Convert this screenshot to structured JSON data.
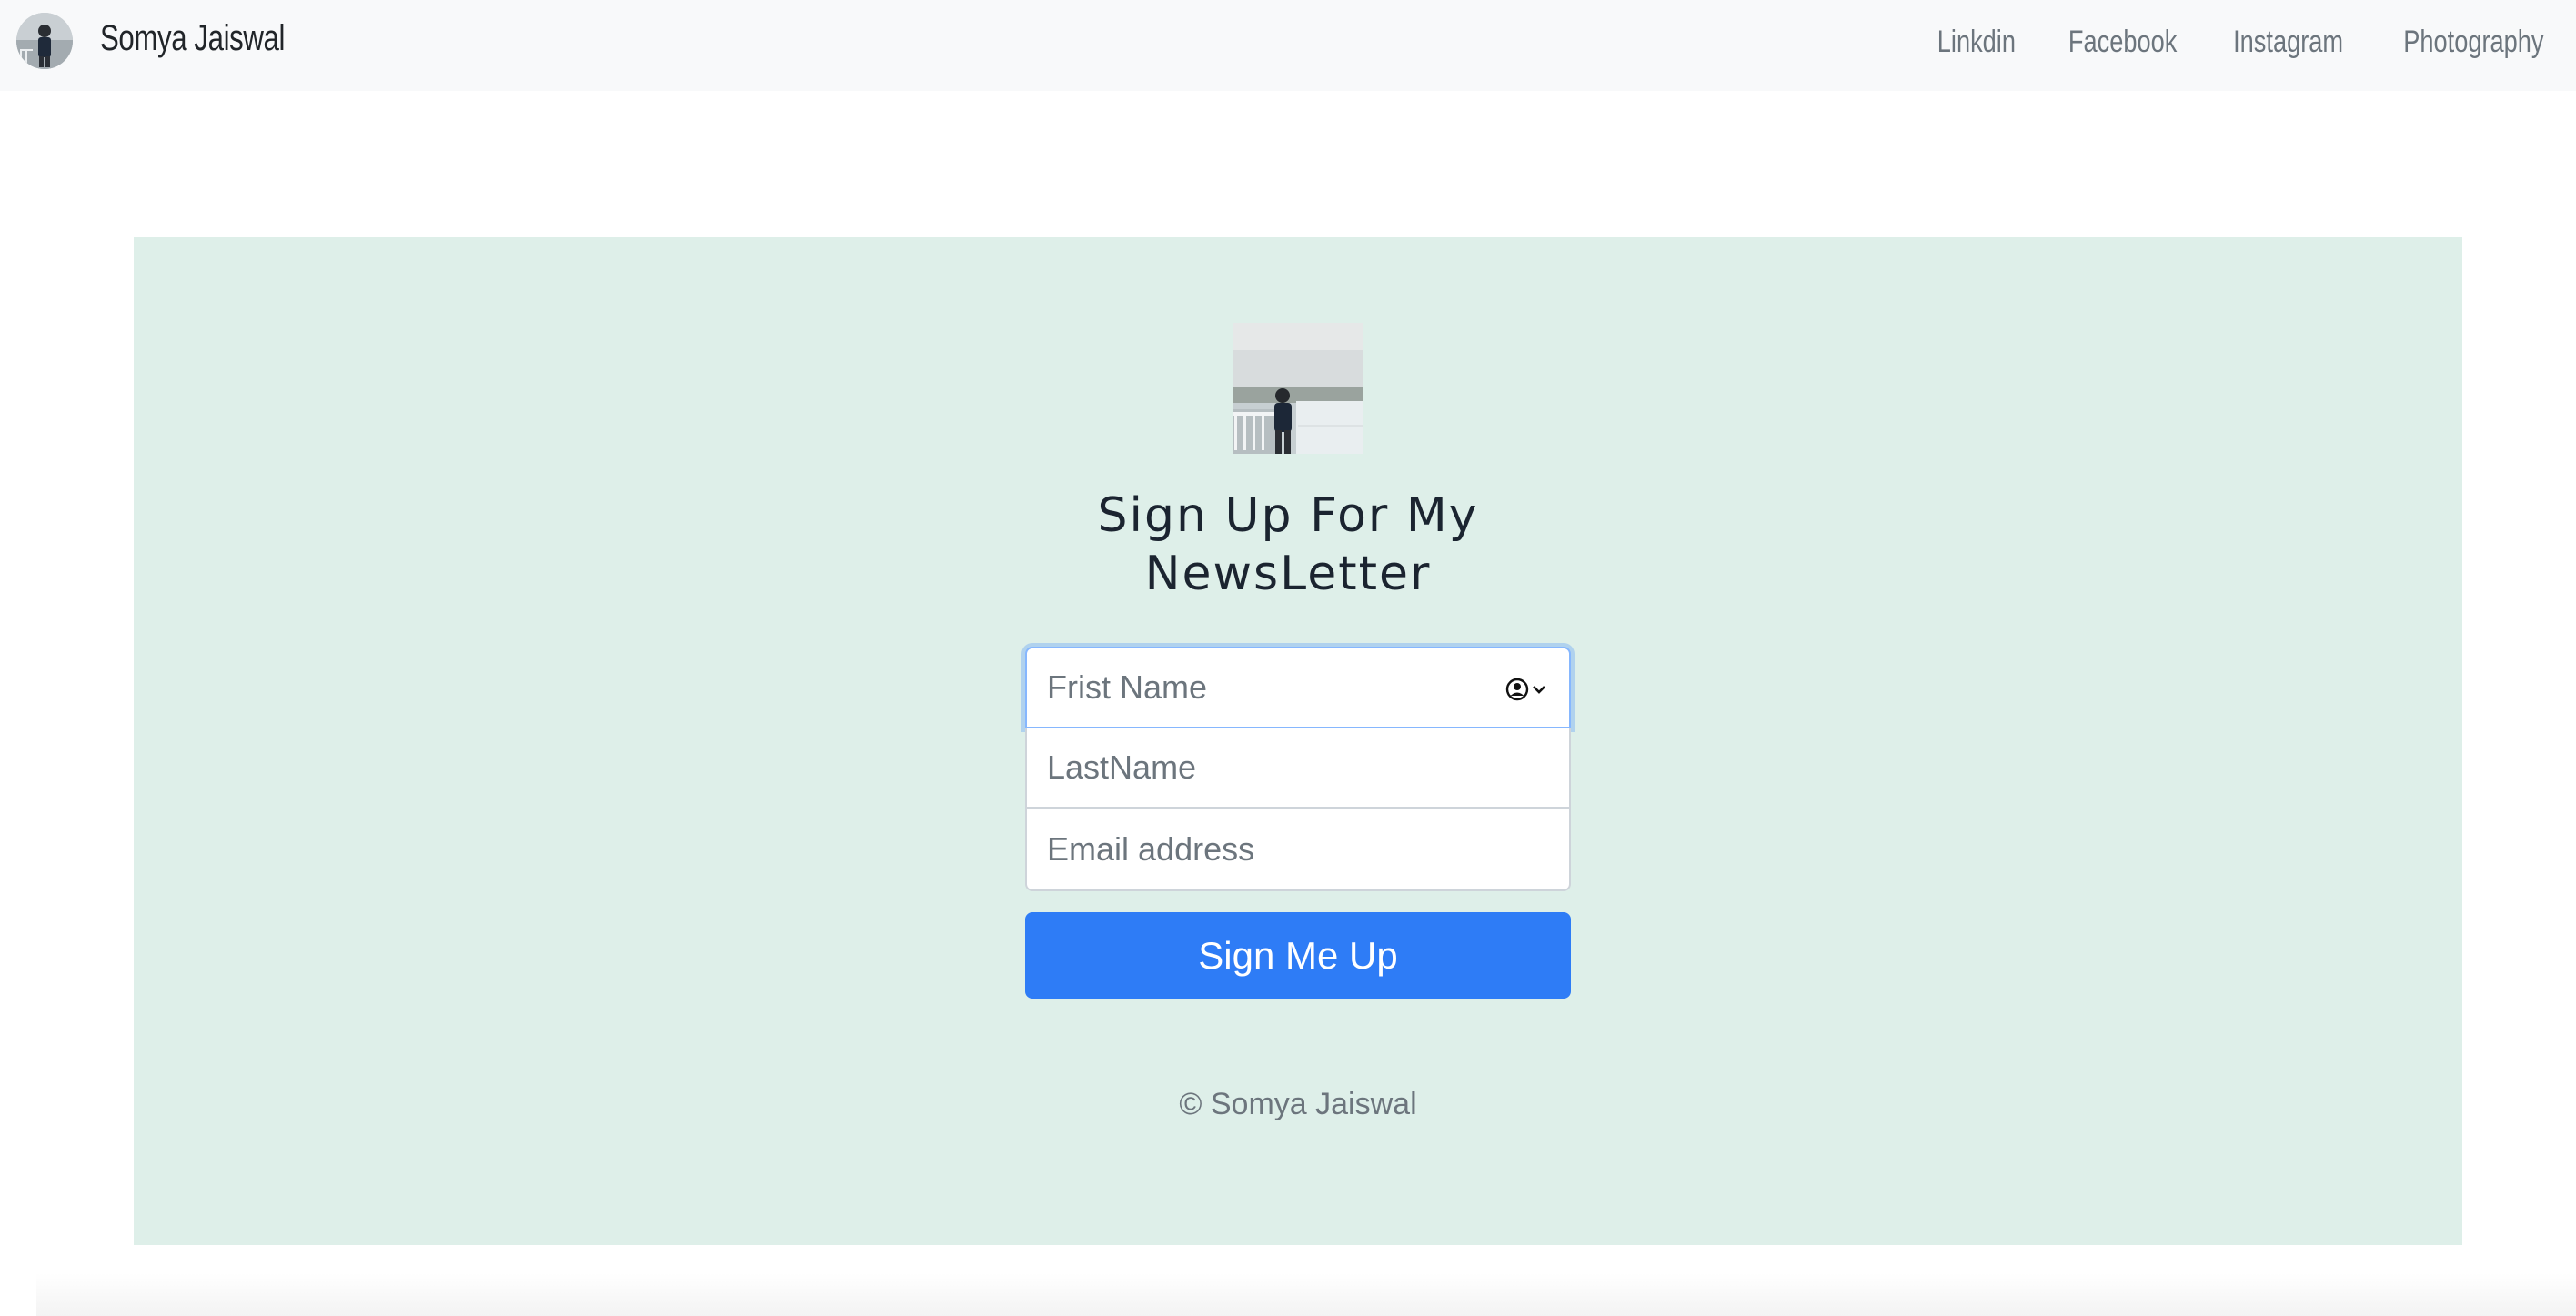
{
  "nav": {
    "brand": "Somya Jaiswal",
    "links": [
      "Linkdin",
      "Facebook",
      "Instagram",
      "Photography"
    ]
  },
  "hero": {
    "heading_line1": "Sign Up For My",
    "heading_line2": "NewsLetter"
  },
  "form": {
    "first_name_placeholder": "Frist Name",
    "last_name_placeholder": "LastName",
    "email_placeholder": "Email address",
    "submit_label": "Sign Me Up"
  },
  "footer": {
    "copyright": "© Somya Jaiswal"
  },
  "colors": {
    "panel_bg": "#deefe9",
    "primary": "#2e7cf6",
    "navbar_bg": "#f8f9fa"
  },
  "icons": [
    "brand-avatar",
    "person-circle-icon",
    "chevron-down-icon"
  ]
}
